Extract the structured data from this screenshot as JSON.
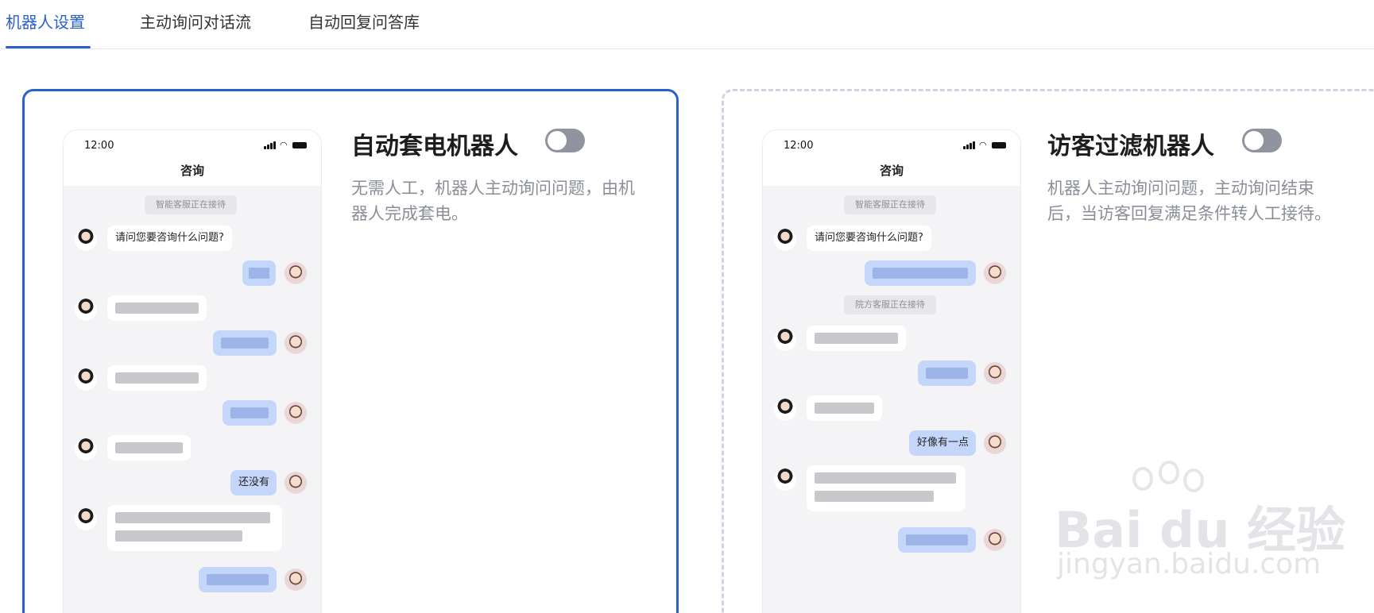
{
  "tabs": [
    {
      "label": "机器人设置",
      "active": true
    },
    {
      "label": "主动询问对话流",
      "active": false
    },
    {
      "label": "自动回复问答库",
      "active": false
    }
  ],
  "colors": {
    "accent": "#2a5fcf",
    "toggle_off": "#8f949f",
    "user_bubble": "#c5d6fb"
  },
  "cards": [
    {
      "title": "自动套电机器人",
      "toggle_on": false,
      "description": [
        "无需人工，机器人主动询问问题，由机",
        "器人完成套电。"
      ],
      "phone": {
        "time": "12:00",
        "title": "咨询",
        "system_notice": "智能客服正在接待",
        "bot_question": "请问您要咨询什么问题?",
        "user_reply": "还没有"
      }
    },
    {
      "title": "访客过滤机器人",
      "toggle_on": false,
      "description": [
        "机器人主动询问问题，主动询问结束",
        "后，当访客回复满足条件转人工接待。"
      ],
      "phone": {
        "time": "12:00",
        "title": "咨询",
        "system_notice": "智能客服正在接待",
        "system_notice_2": "院方客服正在接待",
        "bot_question": "请问您要咨询什么问题?",
        "user_reply": "好像有一点"
      }
    }
  ],
  "watermark": {
    "main": "Bai du 经验",
    "sub": "jingyan.baidu.com"
  }
}
